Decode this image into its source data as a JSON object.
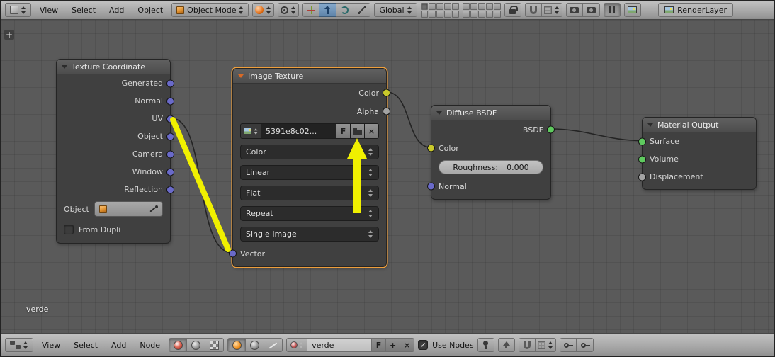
{
  "top_header": {
    "menus": [
      {
        "label": "View"
      },
      {
        "label": "Select"
      },
      {
        "label": "Add"
      },
      {
        "label": "Object"
      }
    ],
    "mode_dropdown": "Object Mode",
    "orientation_dropdown": "Global",
    "renderlayer_field": "RenderLayer"
  },
  "canvas": {
    "tree_name": "verde"
  },
  "nodes": {
    "texture_coordinate": {
      "title": "Texture Coordinate",
      "outputs": [
        "Generated",
        "Normal",
        "UV",
        "Object",
        "Camera",
        "Window",
        "Reflection"
      ],
      "object_field_label": "Object",
      "from_dupli_label": "From Dupli"
    },
    "image_texture": {
      "title": "Image Texture",
      "output_color": "Color",
      "output_alpha": "Alpha",
      "image_name": "5391e8c02...",
      "fake_user": "F",
      "color_space": "Color",
      "interpolation": "Linear",
      "projection": "Flat",
      "extension": "Repeat",
      "source": "Single Image",
      "input_vector": "Vector"
    },
    "diffuse_bsdf": {
      "title": "Diffuse BSDF",
      "output_bsdf": "BSDF",
      "input_color": "Color",
      "roughness_label": "Roughness:",
      "roughness_value": "0.000",
      "input_normal": "Normal"
    },
    "material_output": {
      "title": "Material Output",
      "inputs": [
        "Surface",
        "Volume",
        "Displacement"
      ]
    }
  },
  "bottom_header": {
    "menus": [
      {
        "label": "View"
      },
      {
        "label": "Select"
      },
      {
        "label": "Add"
      },
      {
        "label": "Node"
      }
    ],
    "material_name": "verde",
    "fake_user": "F",
    "use_nodes_label": "Use Nodes"
  },
  "annotations": {
    "highlight_line": "uv-output-to-vector-input",
    "arrow_points_at": "open-image-button",
    "color": "#f0f000"
  },
  "colors": {
    "selection_outline": "#ef9f3c",
    "annotation_yellow": "#f0f000",
    "socket_vector": "#6a6ac9",
    "socket_color": "#c9c92b",
    "socket_value": "#a3a3a3",
    "socket_shader": "#5fca5f"
  },
  "icons": {
    "top_bar": [
      "3d-viewport-editor-icon",
      "object-mode-cube-icon",
      "viewport-shading-sphere-icon",
      "pivot-point-icon",
      "manipulator-axis-icon",
      "translate-manipulator-icon",
      "rotate-manipulator-icon",
      "scale-manipulator-icon",
      "lock-icon",
      "snap-magnet-icon",
      "snap-element-grid-icon",
      "opengl-render-camera-icon",
      "opengl-render-anim-icon",
      "pause-icon",
      "renderlayer-photo-icon"
    ],
    "bottom_bar": [
      "node-editor-icon",
      "shader-nodes-sphere-icon",
      "compositing-nodes-sphere-icon",
      "texture-nodes-checker-icon",
      "object-shader-sphere-icon",
      "world-shader-sphere-icon",
      "linestyle-shader-icon",
      "browse-material-icon",
      "new-material-plus-icon",
      "unlink-x-icon",
      "pin-icon",
      "parent-tree-arrow-icon",
      "snap-magnet-icon",
      "snap-mode-grid-icon",
      "keyframe-insert-icon",
      "keyframe-clear-icon"
    ],
    "nodes": [
      "collapse-triangle-icon",
      "image-browse-photo-icon",
      "open-image-folder-icon",
      "unlink-image-x-icon",
      "object-data-cube-icon",
      "eyedropper-icon"
    ]
  }
}
